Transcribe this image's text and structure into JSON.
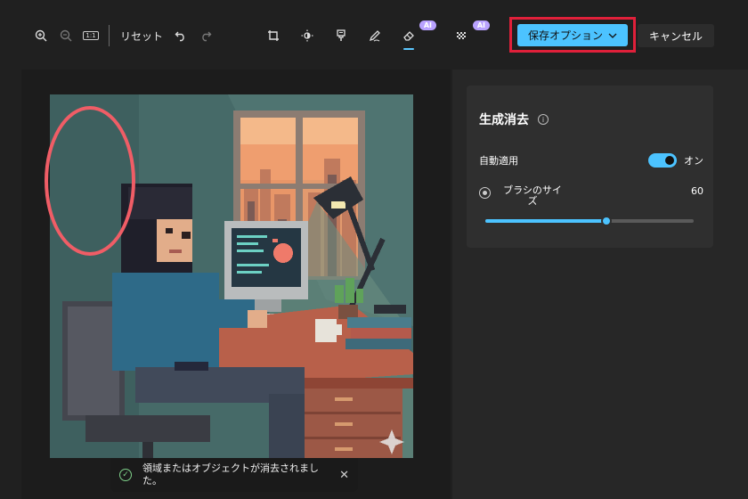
{
  "toolbar": {
    "reset_label": "リセット",
    "fit_label": "1:1",
    "icons": [
      "zoom-in-icon",
      "zoom-out-icon",
      "fit-icon",
      "undo-icon",
      "redo-icon",
      "crop-icon",
      "brightness-icon",
      "filter-icon",
      "markup-icon",
      "erase-icon",
      "background-icon"
    ],
    "ai_badge": "AI",
    "save_label": "保存オプション",
    "cancel_label": "キャンセル"
  },
  "panel": {
    "title": "生成消去",
    "auto_apply_label": "自動適用",
    "auto_apply_state": "オン",
    "brush_size_label": "ブラシのサイズ",
    "brush_size_value": "60",
    "brush_size_fraction": 0.58
  },
  "toast": {
    "message": "領域またはオブジェクトが消去されました。",
    "close": "✕"
  },
  "colors": {
    "accent": "#4cc3ff",
    "highlight_box": "#e0203a",
    "ellipse": "#f05d66",
    "ai_badge": "#b9a2ff"
  }
}
